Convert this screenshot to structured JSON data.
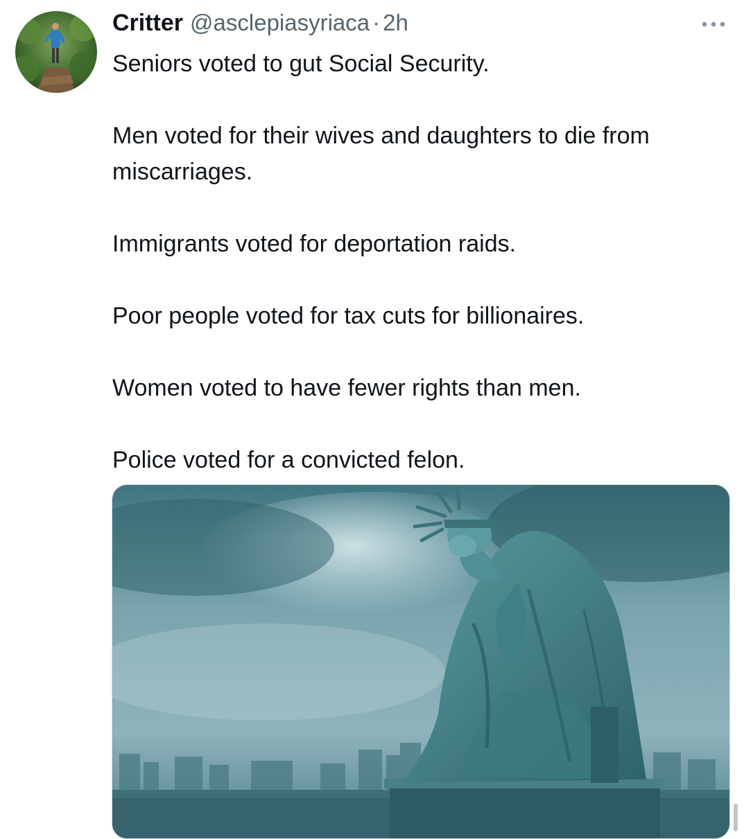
{
  "author": {
    "display_name": "Critter",
    "handle": "@asclepiasyriaca",
    "separator": "·",
    "time": "2h",
    "avatar_icon": "profile-photo-person-in-forest"
  },
  "more_icon": "ellipsis-icon",
  "tweet": {
    "paragraphs": [
      "Seniors voted to gut Social Security.",
      "Men voted for their wives and daughters to die from miscarriages.",
      "Immigrants voted for deportation raids.",
      "Poor people voted for tax cuts for billionaires.",
      "Women voted to have fewer rights than men.",
      "Police voted for a convicted felon."
    ]
  },
  "media": {
    "kind": "image",
    "subject": "statue-of-liberty-weeping"
  },
  "colors": {
    "text": "#0f1419",
    "secondary": "#536471",
    "border": "#cfd9de",
    "statue": "#3f7f86",
    "sky": "#8fb3bb"
  }
}
